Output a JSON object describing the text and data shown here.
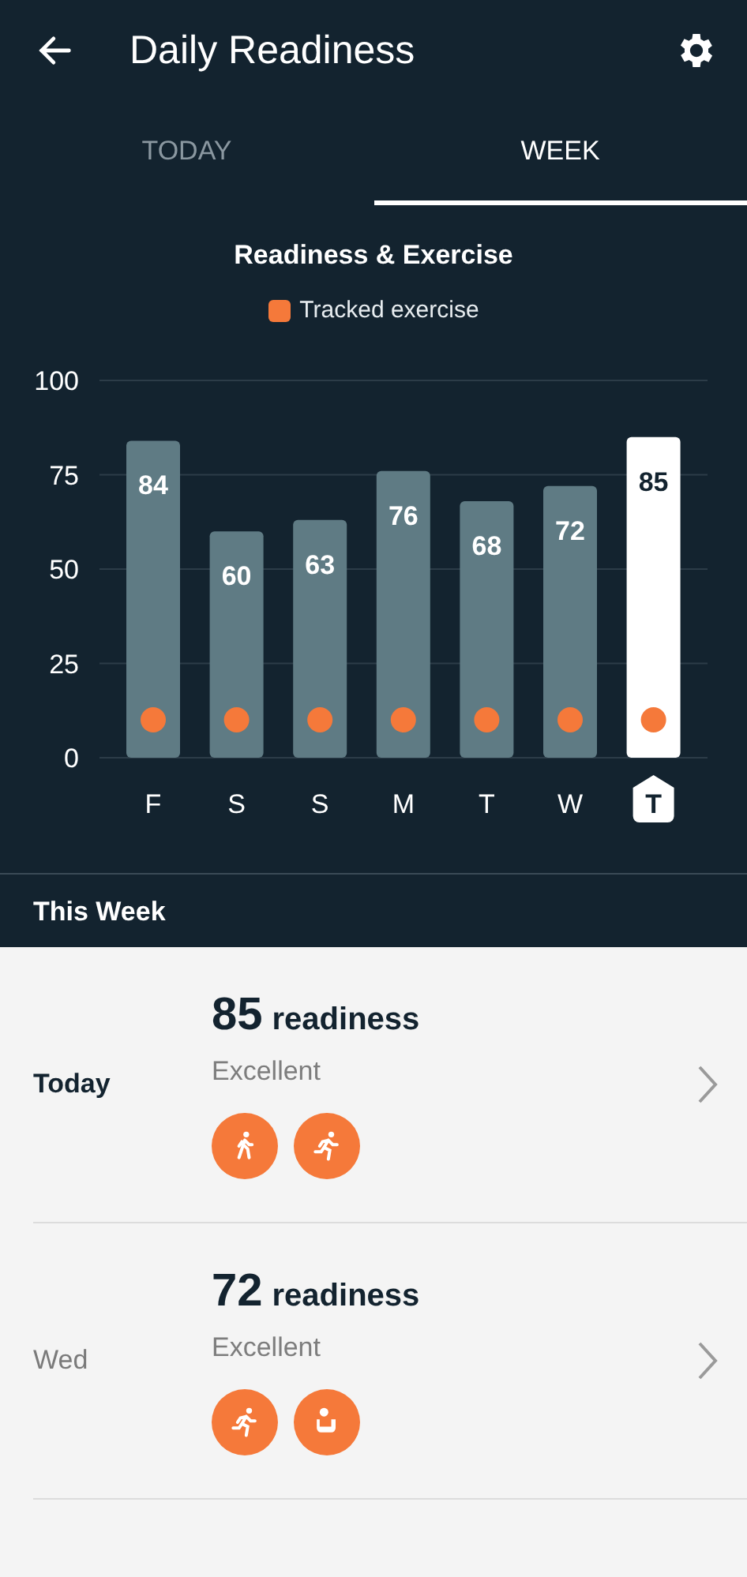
{
  "header": {
    "title": "Daily Readiness"
  },
  "tabs": [
    {
      "label": "TODAY",
      "selected": false
    },
    {
      "label": "WEEK",
      "selected": true
    }
  ],
  "chart": {
    "legend": {
      "label": "Tracked exercise",
      "color": "#f5793a"
    },
    "bar_states": [
      {
        "selected": false,
        "exercise": true,
        "color": "#5f7b84"
      },
      {
        "selected": false,
        "exercise": true,
        "color": "#5f7b84"
      },
      {
        "selected": false,
        "exercise": true,
        "color": "#5f7b84"
      },
      {
        "selected": false,
        "exercise": true,
        "color": "#5f7b84"
      },
      {
        "selected": false,
        "exercise": true,
        "color": "#5f7b84"
      },
      {
        "selected": false,
        "exercise": true,
        "color": "#5f7b84"
      },
      {
        "selected": true,
        "exercise": true,
        "color": "#ffffff"
      }
    ],
    "chart_data": {
      "type": "bar",
      "title": "Readiness & Exercise",
      "categories": [
        "F",
        "S",
        "S",
        "M",
        "T",
        "W",
        "T"
      ],
      "values": [
        84,
        60,
        63,
        76,
        68,
        72,
        85
      ],
      "ylim": [
        0,
        100
      ],
      "yticks": [
        0,
        25,
        50,
        75,
        100
      ],
      "grid": true,
      "data_labels": true
    }
  },
  "section_title": "This Week",
  "days": [
    {
      "label": "Today",
      "current": true,
      "score": "85",
      "unit": "readiness",
      "rating": "Excellent",
      "activities": [
        {
          "kind": "walk"
        },
        {
          "kind": "run"
        }
      ]
    },
    {
      "label": "Wed",
      "current": false,
      "score": "72",
      "unit": "readiness",
      "rating": "Excellent",
      "activities": [
        {
          "kind": "run"
        },
        {
          "kind": "seated"
        }
      ]
    }
  ]
}
